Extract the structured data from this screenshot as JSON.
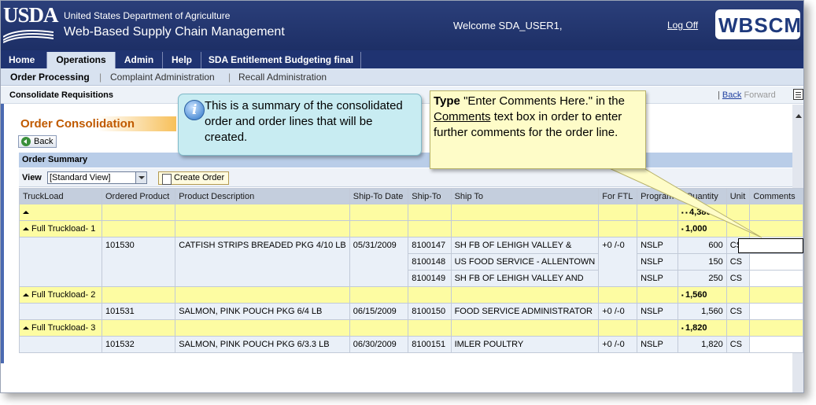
{
  "header": {
    "logo_text": "USDA",
    "department": "United States Department of Agriculture",
    "app_title": "Web-Based Supply Chain Management",
    "welcome": "Welcome SDA_USER1,",
    "logoff": "Log Off",
    "brand": "WBSCM"
  },
  "tabs": [
    {
      "label": "Home"
    },
    {
      "label": "Operations"
    },
    {
      "label": "Admin"
    },
    {
      "label": "Help"
    },
    {
      "label": "SDA Entitlement Budgeting final"
    }
  ],
  "subtabs": [
    {
      "label": "Order Processing"
    },
    {
      "label": "Complaint Administration"
    },
    {
      "label": "Recall Administration"
    }
  ],
  "pagebar": {
    "title": "Consolidate Requisitions",
    "back": "Back",
    "forward": "Forward"
  },
  "page": {
    "title": "Order Consolidation",
    "back_button": "Back"
  },
  "summary": {
    "title": "Order Summary",
    "view_label": "View",
    "view_value": "[Standard View]",
    "create_order": "Create Order"
  },
  "table": {
    "columns": [
      "TruckLoad",
      "Ordered Product",
      "Product Description",
      "Ship-To Date",
      "Ship-To",
      "Ship To",
      "For FTL",
      "Program",
      "Quantity",
      "Unit",
      "Comments"
    ],
    "total_quantity": "4,380",
    "groups": [
      {
        "label": "Full Truckload- 1",
        "quantity": "1,000",
        "product": "101530",
        "description": "CATFISH STRIPS BREADED PKG 4/10 LB",
        "date": "05/31/2009",
        "ftl": "+0 /-0",
        "rows": [
          {
            "ship_to": "8100147",
            "ship_to_name": "SH FB OF LEHIGH VALLEY &",
            "program": "NSLP",
            "quantity": "600",
            "unit": "CS"
          },
          {
            "ship_to": "8100148",
            "ship_to_name": "US FOOD SERVICE - ALLENTOWN",
            "program": "NSLP",
            "quantity": "150",
            "unit": "CS"
          },
          {
            "ship_to": "8100149",
            "ship_to_name": "SH FB OF LEHIGH VALLEY AND",
            "program": "NSLP",
            "quantity": "250",
            "unit": "CS"
          }
        ]
      },
      {
        "label": "Full Truckload- 2",
        "quantity": "1,560",
        "product": "101531",
        "description": "SALMON, PINK POUCH PKG 6/4 LB",
        "date": "06/15/2009",
        "ftl": "+0 /-0",
        "rows": [
          {
            "ship_to": "8100150",
            "ship_to_name": "FOOD SERVICE ADMINISTRATOR",
            "program": "NSLP",
            "quantity": "1,560",
            "unit": "CS"
          }
        ]
      },
      {
        "label": "Full Truckload- 3",
        "quantity": "1,820",
        "product": "101532",
        "description": "SALMON, PINK POUCH PKG 6/3.3 LB",
        "date": "06/30/2009",
        "ftl": "+0 /-0",
        "rows": [
          {
            "ship_to": "8100151",
            "ship_to_name": "IMLER POULTRY",
            "program": "NSLP",
            "quantity": "1,820",
            "unit": "CS"
          }
        ]
      }
    ]
  },
  "callouts": {
    "info": "This is a summary of the consolidated order and order lines that will be created.",
    "tip_bold": "Type",
    "tip_part1": " \"Enter Comments Here.\" in the ",
    "tip_link": "Comments",
    "tip_part2": " text box in order to enter further comments for the order line."
  }
}
